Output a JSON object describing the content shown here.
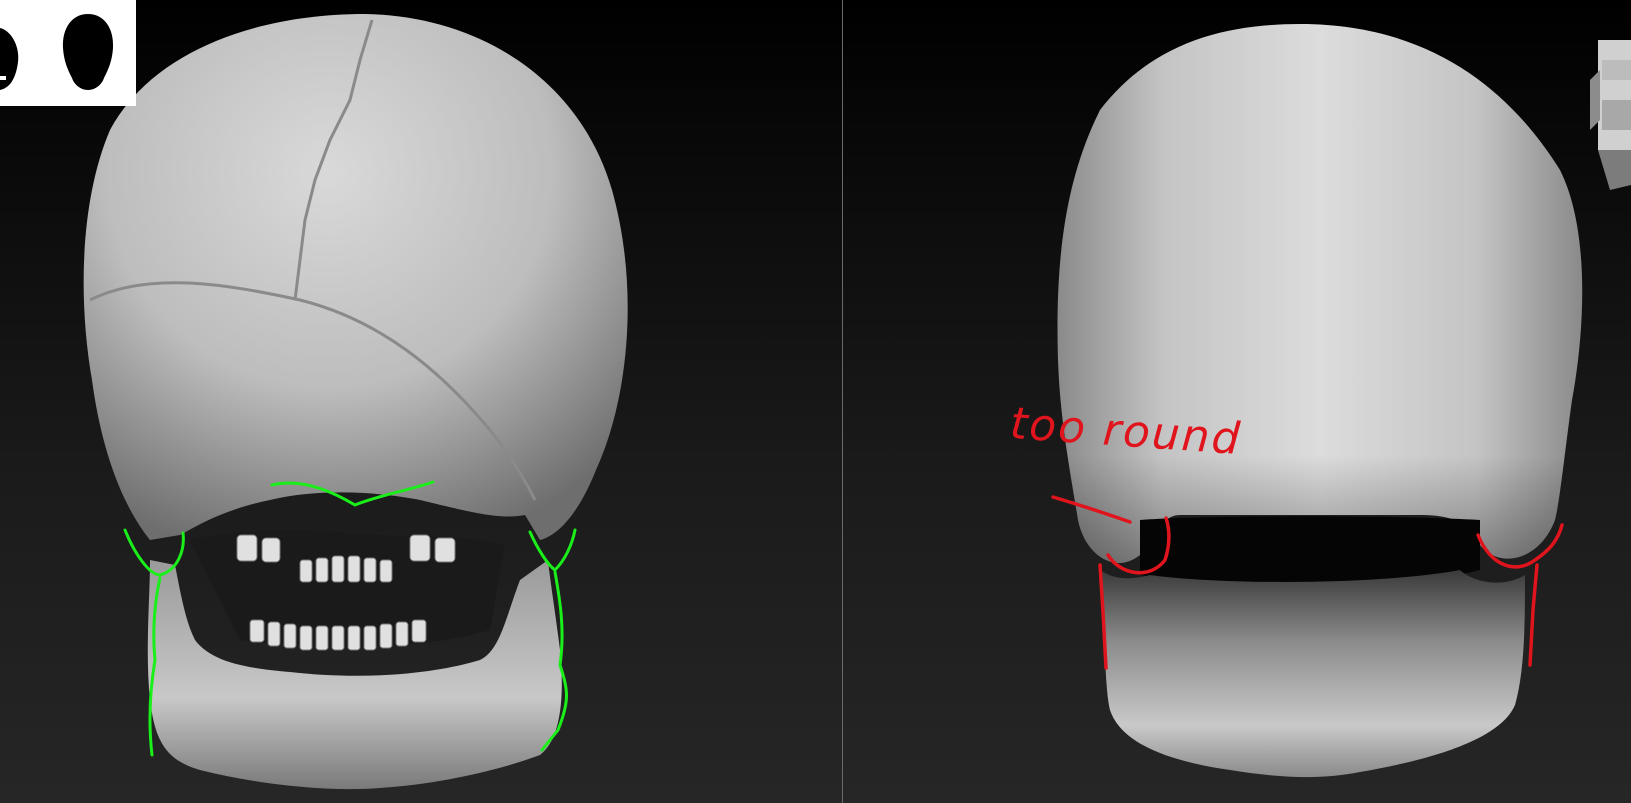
{
  "viewports": {
    "left": {
      "description_name": "reference-skull-view"
    },
    "right": {
      "description_name": "sculpt-view"
    }
  },
  "annotations": {
    "right_note": "too round"
  },
  "colors": {
    "left_guides": "#1aef1a",
    "right_markup": "#e0141c",
    "divider": "#6a6a6a"
  },
  "icons": {
    "thumbnail": "head-silhouette-icon",
    "nav_cube": "navigation-cube-icon"
  }
}
